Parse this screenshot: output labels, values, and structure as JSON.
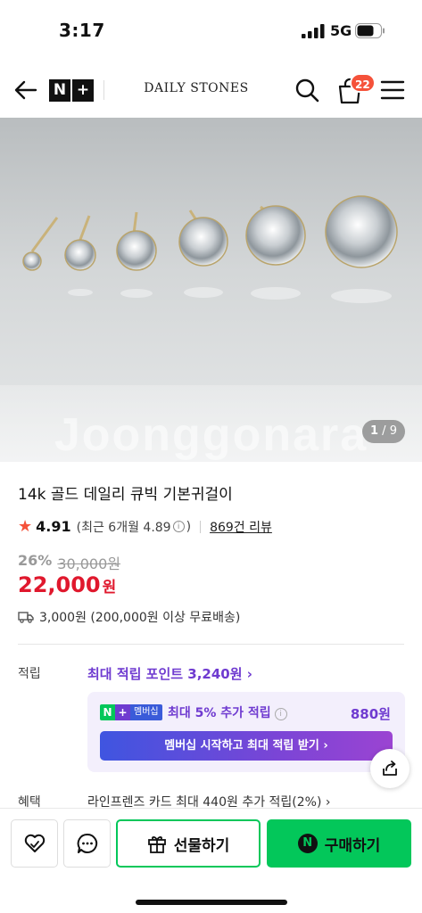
{
  "status_bar": {
    "time": "3:17",
    "network": "5G"
  },
  "header": {
    "logo_left": "N",
    "logo_right": "+",
    "store_name": "DAILY STONES",
    "cart_count": "22"
  },
  "hero": {
    "watermark": "Joonggonara",
    "counter_current": "1",
    "counter_total": "9"
  },
  "product": {
    "title": "14k 골드 데일리 큐빅 기본귀걸이",
    "rating": "4.91",
    "recent_rating": "(최근 6개월 4.89",
    "recent_rating_close": ")",
    "review_count": "869건 리뷰",
    "discount_pct": "26%",
    "original_price": "30,000원",
    "price": "22,000",
    "price_unit": "원",
    "shipping": "3,000원 (200,000원 이상 무료배송)"
  },
  "points": {
    "label": "적립",
    "max_points_link": "최대 적립 포인트 3,240원",
    "badge_n": "N",
    "badge_plus": "+",
    "badge_member": "멤버십",
    "extra_text": "최대 5% 추가 적립",
    "extra_amount": "880원",
    "cta": "멤버십 시작하고 최대 적립 받기"
  },
  "benefits": {
    "label": "혜택",
    "text": "라인프렌즈 카드 최대 440원 추가 적립(2%)"
  },
  "bottom_bar": {
    "gift_label": "선물하기",
    "buy_label": "구매하기",
    "buy_logo": "N"
  },
  "colors": {
    "accent_green": "#03c75a",
    "price_red": "#e0182d",
    "points_purple": "#6f3bd0",
    "badge_orange": "#f5523a"
  }
}
